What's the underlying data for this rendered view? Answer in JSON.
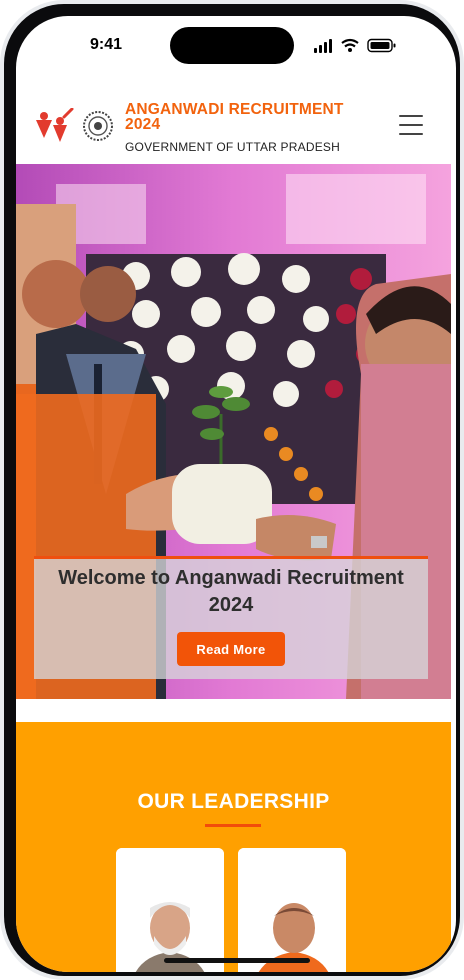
{
  "status_bar": {
    "time": "9:41"
  },
  "header": {
    "title": "ANGANWADI RECRUITMENT 2024",
    "subtitle": "GOVERNMENT OF UTTAR PRADESH",
    "menu_icon": "hamburger-menu-icon",
    "logo_icon": "anganwadi-logo-icon",
    "seal_icon": "government-seal-icon"
  },
  "hero": {
    "heading": "Welcome to Anganwadi Recruitment 2024",
    "button_label": "Read More"
  },
  "leadership": {
    "heading": "OUR LEADERSHIP"
  },
  "colors": {
    "brand_orange": "#f2630e",
    "button_orange": "#f25408",
    "section_yellow": "#ffa000"
  }
}
